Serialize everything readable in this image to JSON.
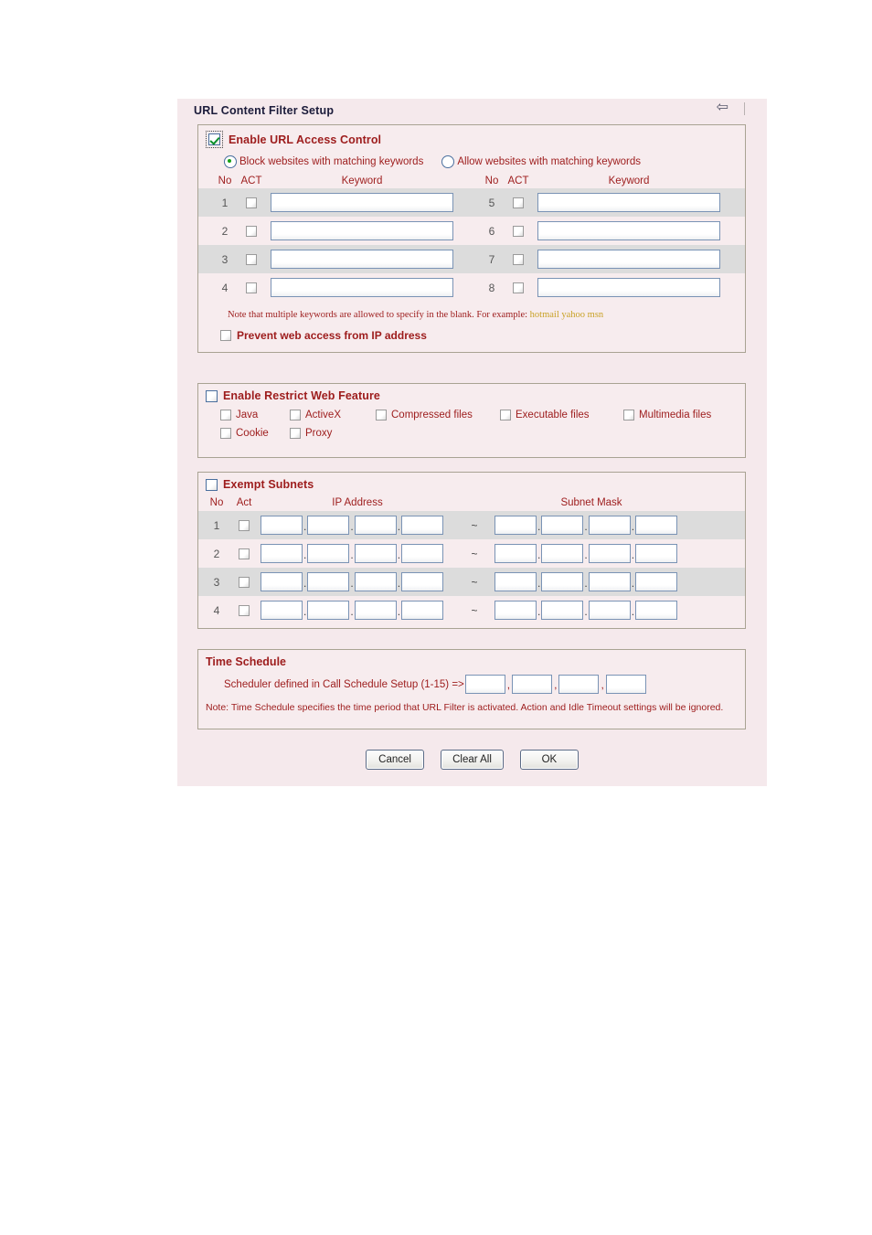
{
  "window": {
    "title": "URL Content Filter Setup",
    "back_arrow_icon": "left-arrow-icon"
  },
  "url_access": {
    "enable_label": "Enable URL Access Control",
    "enable_checked": true,
    "mode_options": [
      {
        "label": "Block websites with matching keywords",
        "selected": true
      },
      {
        "label": "Allow websites with matching keywords",
        "selected": false
      }
    ],
    "columns": {
      "no": "No",
      "act": "ACT",
      "keyword": "Keyword"
    },
    "rows_left": [
      {
        "no": "1",
        "act_checked": false,
        "keyword": ""
      },
      {
        "no": "2",
        "act_checked": false,
        "keyword": ""
      },
      {
        "no": "3",
        "act_checked": false,
        "keyword": ""
      },
      {
        "no": "4",
        "act_checked": false,
        "keyword": ""
      }
    ],
    "rows_right": [
      {
        "no": "5",
        "act_checked": false,
        "keyword": ""
      },
      {
        "no": "6",
        "act_checked": false,
        "keyword": ""
      },
      {
        "no": "7",
        "act_checked": false,
        "keyword": ""
      },
      {
        "no": "8",
        "act_checked": false,
        "keyword": ""
      }
    ],
    "note_text": "Note that multiple keywords are allowed to specify in the blank. For example:",
    "note_example": "hotmail yahoo msn",
    "prevent_label": "Prevent web access from IP address",
    "prevent_checked": false
  },
  "restrict_web": {
    "enable_label": "Enable Restrict Web Feature",
    "enable_checked": false,
    "row1": [
      {
        "label": "Java",
        "checked": false
      },
      {
        "label": "ActiveX",
        "checked": false
      },
      {
        "label": "Compressed files",
        "checked": false
      },
      {
        "label": "Executable files",
        "checked": false
      },
      {
        "label": "Multimedia files",
        "checked": false
      }
    ],
    "row2": [
      {
        "label": "Cookie",
        "checked": false
      },
      {
        "label": "Proxy",
        "checked": false
      }
    ]
  },
  "exempt_subnets": {
    "enable_label": "Exempt Subnets",
    "enable_checked": false,
    "columns": {
      "no": "No",
      "act": "Act",
      "ip": "IP Address",
      "mask": "Subnet Mask"
    },
    "separator": "~",
    "rows": [
      {
        "no": "1",
        "act_checked": false,
        "ip": [
          "",
          "",
          "",
          ""
        ],
        "mask": [
          "",
          "",
          "",
          ""
        ]
      },
      {
        "no": "2",
        "act_checked": false,
        "ip": [
          "",
          "",
          "",
          ""
        ],
        "mask": [
          "",
          "",
          "",
          ""
        ]
      },
      {
        "no": "3",
        "act_checked": false,
        "ip": [
          "",
          "",
          "",
          ""
        ],
        "mask": [
          "",
          "",
          "",
          ""
        ]
      },
      {
        "no": "4",
        "act_checked": false,
        "ip": [
          "",
          "",
          "",
          ""
        ],
        "mask": [
          "",
          "",
          "",
          ""
        ]
      }
    ]
  },
  "time_schedule": {
    "title": "Time Schedule",
    "scheduler_label": "Scheduler defined in Call Schedule Setup (1-15) =>",
    "scheduler_values": [
      "",
      "",
      "",
      ""
    ],
    "note": "Note: Time Schedule specifies the time period that URL Filter is activated. Action and Idle Timeout settings will be ignored."
  },
  "buttons": {
    "cancel": "Cancel",
    "clear_all": "Clear All",
    "ok": "OK"
  },
  "colors": {
    "heading_red": "#9d1c1c",
    "panel_pink": "#f7ecee",
    "row_gray": "#dcdcdc",
    "border_tan": "#a9a393",
    "example_gold": "#c9a227",
    "title_navy": "#1b1b3a"
  }
}
